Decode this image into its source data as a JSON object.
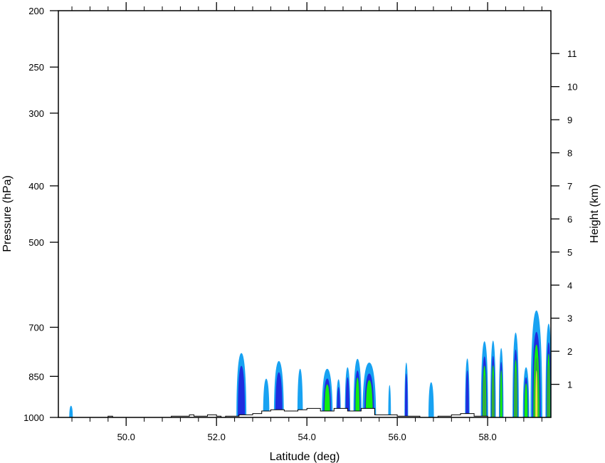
{
  "chart_data": {
    "type": "contour",
    "xlabel": "Latitude (deg)",
    "ylabel": "Pressure (hPa)",
    "y2label": "Height (km)",
    "xlim": [
      48.5,
      59.4
    ],
    "ylim": [
      1000,
      200
    ],
    "y_scale": "log",
    "x_ticks": [
      50.0,
      52.0,
      54.0,
      56.0,
      58.0
    ],
    "x_tick_labels": [
      "50.0",
      "52.0",
      "54.0",
      "56.0",
      "58.0"
    ],
    "y_ticks": [
      1000,
      850,
      700,
      500,
      400,
      300,
      250,
      200
    ],
    "y_tick_labels": [
      "1000",
      "850",
      "700",
      "500",
      "400",
      "300",
      "250",
      "200"
    ],
    "height_ticks_km": [
      1,
      2,
      3,
      4,
      5,
      6,
      7,
      8,
      9,
      10,
      11
    ],
    "height_tick_labels": [
      "1",
      "2",
      "3",
      "4",
      "5",
      "6",
      "7",
      "8",
      "9",
      "10",
      "11"
    ],
    "colors": {
      "level1": "#18a2f2",
      "level2": "#1f2dde",
      "level3": "#11ee11",
      "level4": "#3aa83a",
      "level5": "#f2e640",
      "terrain": "#000000"
    },
    "terrain": [
      [
        48.5,
        1000
      ],
      [
        49.6,
        1000
      ],
      [
        49.6,
        995
      ],
      [
        49.7,
        995
      ],
      [
        49.7,
        1000
      ],
      [
        51.0,
        1000
      ],
      [
        51.0,
        995
      ],
      [
        51.4,
        995
      ],
      [
        51.4,
        990
      ],
      [
        51.5,
        990
      ],
      [
        51.5,
        995
      ],
      [
        51.8,
        995
      ],
      [
        51.8,
        990
      ],
      [
        52.0,
        990
      ],
      [
        52.0,
        995
      ],
      [
        52.1,
        995
      ],
      [
        52.1,
        1000
      ],
      [
        52.2,
        1000
      ],
      [
        52.2,
        995
      ],
      [
        52.5,
        995
      ],
      [
        52.5,
        990
      ],
      [
        52.8,
        990
      ],
      [
        52.8,
        985
      ],
      [
        53.0,
        985
      ],
      [
        53.0,
        975
      ],
      [
        53.2,
        975
      ],
      [
        53.2,
        970
      ],
      [
        53.5,
        970
      ],
      [
        53.5,
        975
      ],
      [
        53.8,
        975
      ],
      [
        53.8,
        970
      ],
      [
        54.0,
        970
      ],
      [
        54.0,
        965
      ],
      [
        54.3,
        965
      ],
      [
        54.3,
        975
      ],
      [
        54.6,
        975
      ],
      [
        54.6,
        965
      ],
      [
        54.9,
        965
      ],
      [
        54.9,
        975
      ],
      [
        55.2,
        975
      ],
      [
        55.2,
        965
      ],
      [
        55.5,
        965
      ],
      [
        55.5,
        990
      ],
      [
        56.0,
        990
      ],
      [
        56.0,
        995
      ],
      [
        56.5,
        995
      ],
      [
        56.5,
        1000
      ],
      [
        56.9,
        1000
      ],
      [
        56.9,
        995
      ],
      [
        57.2,
        995
      ],
      [
        57.2,
        990
      ],
      [
        57.4,
        990
      ],
      [
        57.4,
        985
      ],
      [
        57.7,
        985
      ],
      [
        57.7,
        995
      ],
      [
        58.0,
        995
      ],
      [
        58.0,
        1000
      ],
      [
        59.4,
        1000
      ]
    ],
    "cells": [
      {
        "lat": 48.78,
        "p_top": 955,
        "half_width": 0.04,
        "levels": 1
      },
      {
        "lat": 52.55,
        "p_top": 775,
        "half_width": 0.11,
        "levels": 2
      },
      {
        "lat": 53.1,
        "p_top": 858,
        "half_width": 0.07,
        "levels": 1
      },
      {
        "lat": 53.38,
        "p_top": 800,
        "half_width": 0.11,
        "levels": 2
      },
      {
        "lat": 53.85,
        "p_top": 825,
        "half_width": 0.06,
        "levels": 1
      },
      {
        "lat": 54.45,
        "p_top": 825,
        "half_width": 0.12,
        "levels": 3
      },
      {
        "lat": 54.7,
        "p_top": 860,
        "half_width": 0.05,
        "levels": 2
      },
      {
        "lat": 54.9,
        "p_top": 820,
        "half_width": 0.06,
        "levels": 2
      },
      {
        "lat": 55.12,
        "p_top": 793,
        "half_width": 0.09,
        "levels": 3
      },
      {
        "lat": 55.38,
        "p_top": 805,
        "half_width": 0.15,
        "levels": 3
      },
      {
        "lat": 55.83,
        "p_top": 880,
        "half_width": 0.03,
        "levels": 1
      },
      {
        "lat": 56.2,
        "p_top": 805,
        "half_width": 0.04,
        "levels": 2
      },
      {
        "lat": 56.75,
        "p_top": 870,
        "half_width": 0.06,
        "levels": 1
      },
      {
        "lat": 57.55,
        "p_top": 792,
        "half_width": 0.05,
        "levels": 2
      },
      {
        "lat": 57.93,
        "p_top": 740,
        "half_width": 0.08,
        "levels": 4
      },
      {
        "lat": 58.12,
        "p_top": 738,
        "half_width": 0.06,
        "levels": 4
      },
      {
        "lat": 58.3,
        "p_top": 760,
        "half_width": 0.05,
        "levels": 3
      },
      {
        "lat": 58.62,
        "p_top": 715,
        "half_width": 0.07,
        "levels": 4
      },
      {
        "lat": 58.85,
        "p_top": 820,
        "half_width": 0.07,
        "levels": 3
      },
      {
        "lat": 59.08,
        "p_top": 655,
        "half_width": 0.13,
        "levels": 5
      },
      {
        "lat": 59.35,
        "p_top": 690,
        "half_width": 0.07,
        "levels": 4
      }
    ]
  }
}
